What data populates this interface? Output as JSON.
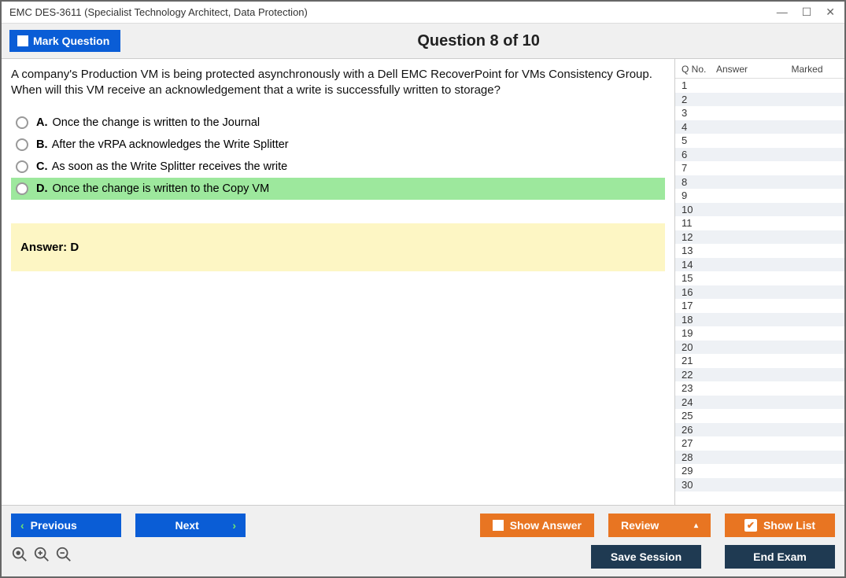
{
  "titlebar": {
    "title": "EMC DES-3611 (Specialist Technology Architect, Data Protection)"
  },
  "header": {
    "mark": "Mark Question",
    "question_title": "Question 8 of 10"
  },
  "question": {
    "text": "A company's Production VM is being protected asynchronously with a Dell EMC RecoverPoint for VMs Consistency Group. When will this VM receive an acknowledgement that a write is successfully written to storage?",
    "options": [
      {
        "letter": "A.",
        "text": "Once the change is written to the Journal",
        "correct": false
      },
      {
        "letter": "B.",
        "text": "After the vRPA acknowledges the Write Splitter",
        "correct": false
      },
      {
        "letter": "C.",
        "text": "As soon as the Write Splitter receives the write",
        "correct": false
      },
      {
        "letter": "D.",
        "text": "Once the change is written to the Copy VM",
        "correct": true
      }
    ],
    "answer_label": "Answer: D"
  },
  "sidebar": {
    "headers": {
      "q": "Q No.",
      "a": "Answer",
      "m": "Marked"
    },
    "total_rows": 30
  },
  "footer": {
    "previous": "Previous",
    "next": "Next",
    "show_answer": "Show Answer",
    "review": "Review",
    "show_list": "Show List",
    "save_session": "Save Session",
    "end_exam": "End Exam"
  }
}
